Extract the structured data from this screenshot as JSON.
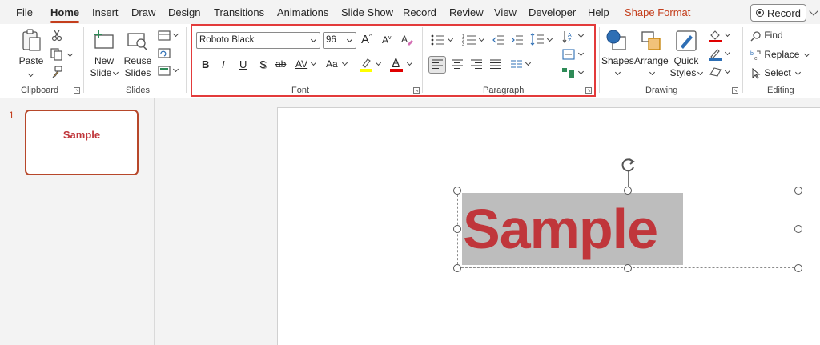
{
  "tabs": [
    {
      "id": "file",
      "label": "File"
    },
    {
      "id": "home",
      "label": "Home",
      "active": true
    },
    {
      "id": "insert",
      "label": "Insert"
    },
    {
      "id": "draw",
      "label": "Draw"
    },
    {
      "id": "design",
      "label": "Design"
    },
    {
      "id": "transitions",
      "label": "Transitions"
    },
    {
      "id": "animations",
      "label": "Animations"
    },
    {
      "id": "slideshow",
      "label": "Slide Show"
    },
    {
      "id": "record",
      "label": "Record"
    },
    {
      "id": "review",
      "label": "Review"
    },
    {
      "id": "view",
      "label": "View"
    },
    {
      "id": "developer",
      "label": "Developer"
    },
    {
      "id": "help",
      "label": "Help"
    },
    {
      "id": "shapeformat",
      "label": "Shape Format",
      "contextual": true
    }
  ],
  "record_button": "Record",
  "ribbon": {
    "clipboard": {
      "label": "Clipboard",
      "paste": "Paste"
    },
    "slides": {
      "label": "Slides",
      "new_slide_1": "New",
      "new_slide_2": "Slide",
      "reuse_1": "Reuse",
      "reuse_2": "Slides"
    },
    "font": {
      "label": "Font",
      "family": "Roboto Black",
      "size": "96",
      "bold": "B",
      "italic": "I",
      "underline": "U",
      "shadow": "S",
      "strike": "ab",
      "spacing": "AV",
      "case": "Aa",
      "grow": "A",
      "shrink": "A",
      "color_letter": "A",
      "highlight_color": "#ffff00",
      "font_color": "#e00000"
    },
    "paragraph": {
      "label": "Paragraph"
    },
    "drawing": {
      "label": "Drawing",
      "shapes": "Shapes",
      "arrange": "Arrange",
      "quick_1": "Quick",
      "quick_2": "Styles"
    },
    "editing": {
      "label": "Editing",
      "find": "Find",
      "replace": "Replace",
      "select": "Select"
    }
  },
  "thumbnails": [
    {
      "number": "1",
      "text": "Sample"
    }
  ],
  "slide": {
    "text": "Sample",
    "text_color": "#c0363b"
  },
  "colors": {
    "accent": "#c43e1c",
    "highlight_box": "#e33b3b"
  }
}
